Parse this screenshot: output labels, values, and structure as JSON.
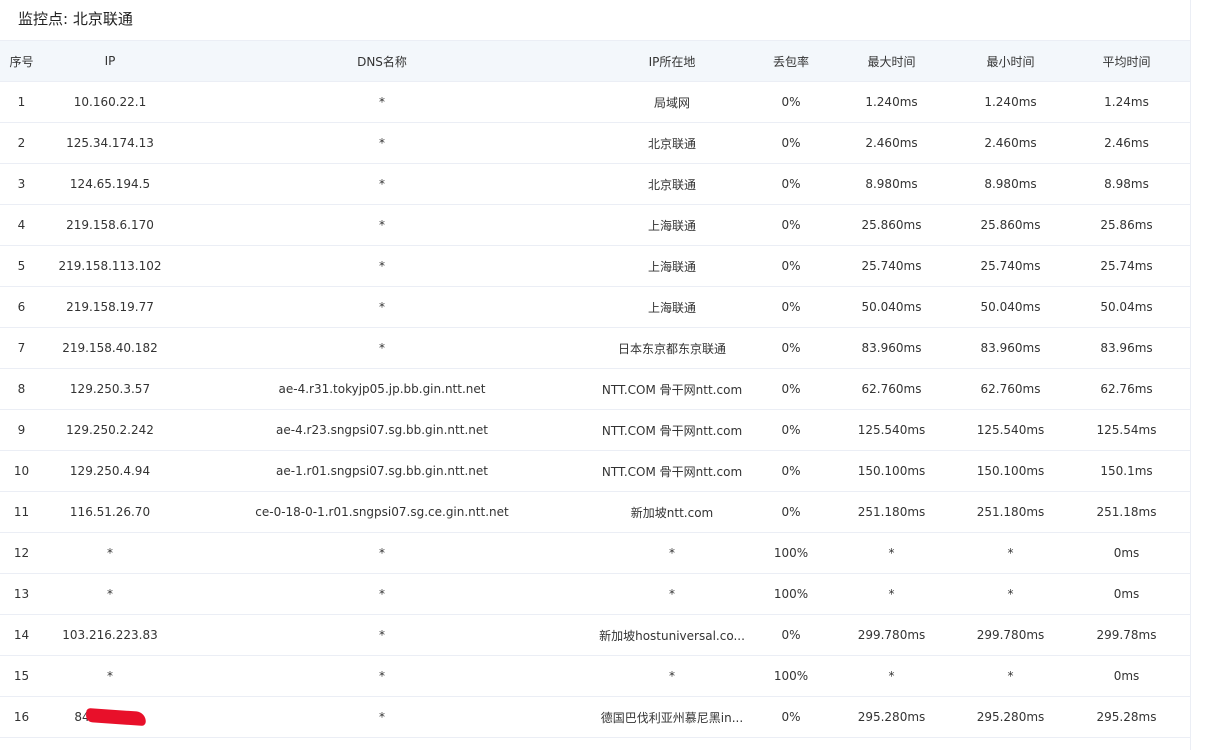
{
  "page": {
    "title": "监控点: 北京联通"
  },
  "table": {
    "headers": [
      "序号",
      "IP",
      "DNS名称",
      "IP所在地",
      "丢包率",
      "最大时间",
      "最小时间",
      "平均时间"
    ],
    "rows": [
      [
        "1",
        "10.160.22.1",
        "*",
        "局域网",
        "0%",
        "1.240ms",
        "1.240ms",
        "1.24ms"
      ],
      [
        "2",
        "125.34.174.13",
        "*",
        "北京联通",
        "0%",
        "2.460ms",
        "2.460ms",
        "2.46ms"
      ],
      [
        "3",
        "124.65.194.5",
        "*",
        "北京联通",
        "0%",
        "8.980ms",
        "8.980ms",
        "8.98ms"
      ],
      [
        "4",
        "219.158.6.170",
        "*",
        "上海联通",
        "0%",
        "25.860ms",
        "25.860ms",
        "25.86ms"
      ],
      [
        "5",
        "219.158.113.102",
        "*",
        "上海联通",
        "0%",
        "25.740ms",
        "25.740ms",
        "25.74ms"
      ],
      [
        "6",
        "219.158.19.77",
        "*",
        "上海联通",
        "0%",
        "50.040ms",
        "50.040ms",
        "50.04ms"
      ],
      [
        "7",
        "219.158.40.182",
        "*",
        "日本东京都东京联通",
        "0%",
        "83.960ms",
        "83.960ms",
        "83.96ms"
      ],
      [
        "8",
        "129.250.3.57",
        "ae-4.r31.tokyjp05.jp.bb.gin.ntt.net",
        "NTT.COM 骨干网ntt.com",
        "0%",
        "62.760ms",
        "62.760ms",
        "62.76ms"
      ],
      [
        "9",
        "129.250.2.242",
        "ae-4.r23.sngpsi07.sg.bb.gin.ntt.net",
        "NTT.COM 骨干网ntt.com",
        "0%",
        "125.540ms",
        "125.540ms",
        "125.54ms"
      ],
      [
        "10",
        "129.250.4.94",
        "ae-1.r01.sngpsi07.sg.bb.gin.ntt.net",
        "NTT.COM 骨干网ntt.com",
        "0%",
        "150.100ms",
        "150.100ms",
        "150.1ms"
      ],
      [
        "11",
        "116.51.26.70",
        "ce-0-18-0-1.r01.sngpsi07.sg.ce.gin.ntt.net",
        "新加坡ntt.com",
        "0%",
        "251.180ms",
        "251.180ms",
        "251.18ms"
      ],
      [
        "12",
        "*",
        "*",
        "*",
        "100%",
        "*",
        "*",
        "0ms"
      ],
      [
        "13",
        "*",
        "*",
        "*",
        "100%",
        "*",
        "*",
        "0ms"
      ],
      [
        "14",
        "103.216.223.83",
        "*",
        "新加坡hostuniversal.co...",
        "0%",
        "299.780ms",
        "299.780ms",
        "299.78ms"
      ],
      [
        "15",
        "*",
        "*",
        "*",
        "100%",
        "*",
        "*",
        "0ms"
      ],
      [
        "16",
        "84",
        "*",
        "德国巴伐利亚州慕尼黑in...",
        "0%",
        "295.280ms",
        "295.280ms",
        "295.28ms"
      ]
    ],
    "redacted_row": 15
  },
  "colors": {
    "header_bg": "#f3f7fb",
    "border": "#ebeef5",
    "redaction": "#e8102a"
  }
}
